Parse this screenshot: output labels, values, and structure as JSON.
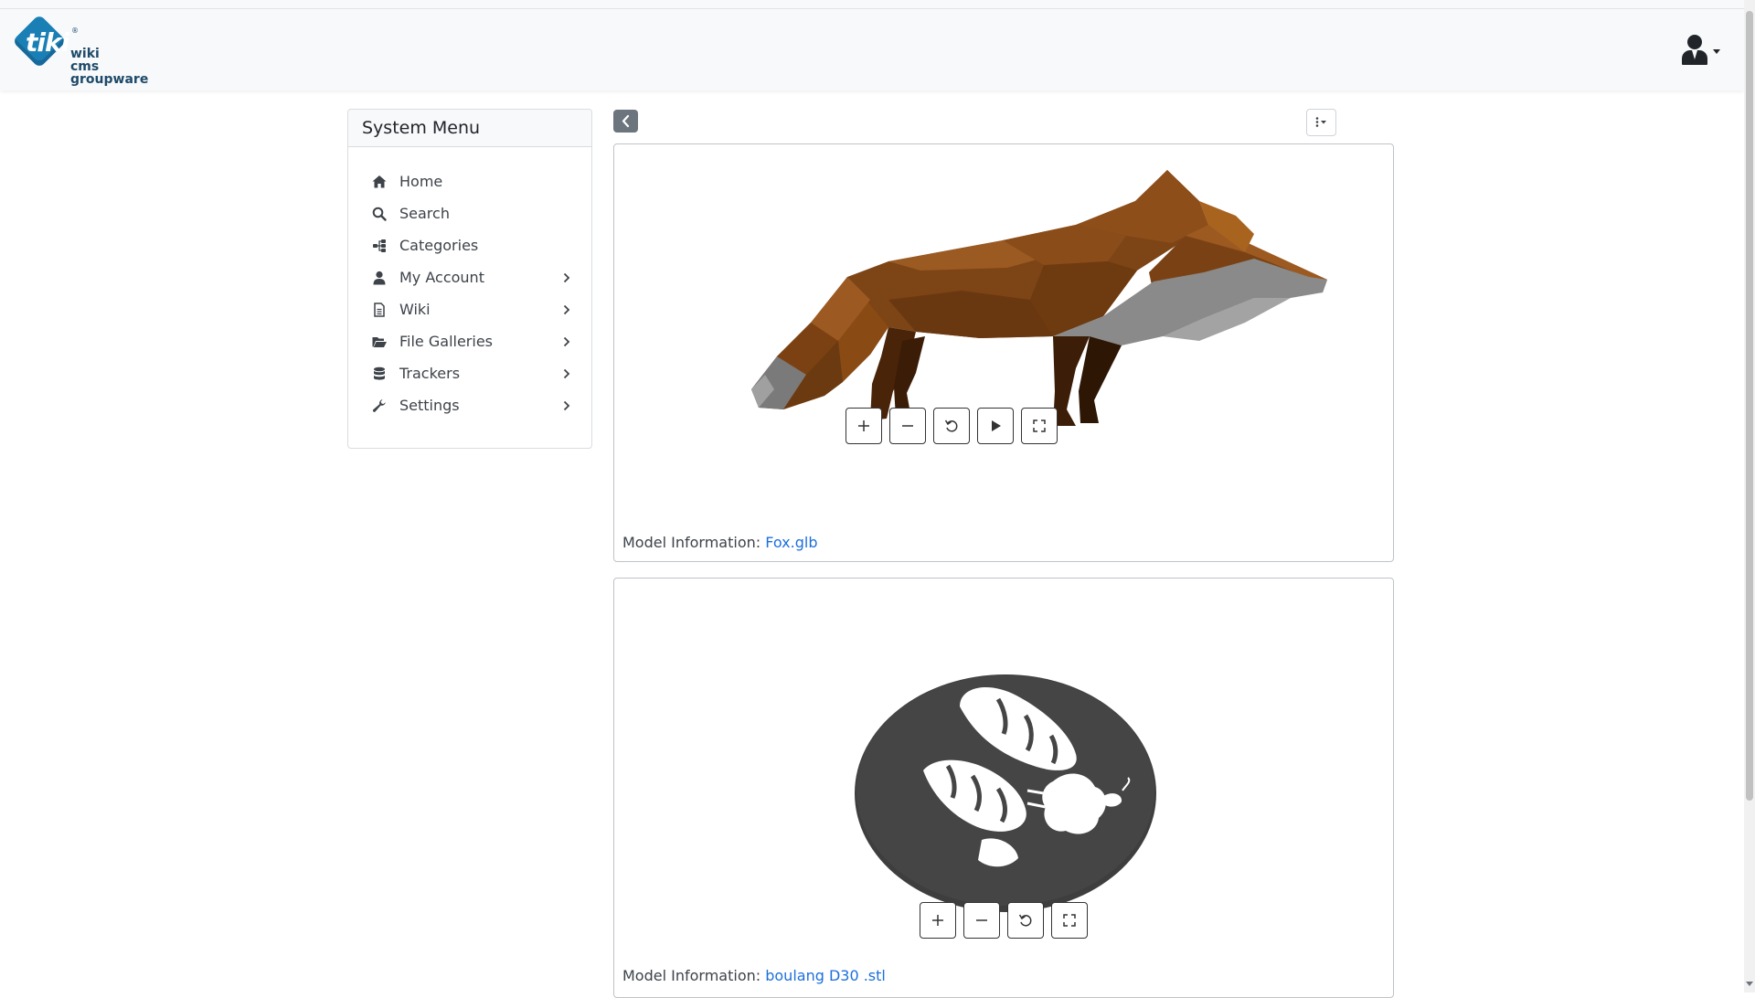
{
  "header": {
    "logo_main": "tiki",
    "logo_reg": "®",
    "logo_lines": [
      "wiki",
      "cms",
      "groupware"
    ],
    "user_menu_icon": "user-tie-icon"
  },
  "system_menu": {
    "title": "System Menu",
    "items": [
      {
        "label": "Home",
        "icon": "home-icon",
        "has_submenu": false
      },
      {
        "label": "Search",
        "icon": "search-icon",
        "has_submenu": false
      },
      {
        "label": "Categories",
        "icon": "sitemap-icon",
        "has_submenu": false
      },
      {
        "label": "My Account",
        "icon": "user-icon",
        "has_submenu": true
      },
      {
        "label": "Wiki",
        "icon": "file-text-icon",
        "has_submenu": true
      },
      {
        "label": "File Galleries",
        "icon": "folder-open-icon",
        "has_submenu": true
      },
      {
        "label": "Trackers",
        "icon": "database-icon",
        "has_submenu": true
      },
      {
        "label": "Settings",
        "icon": "wrench-icon",
        "has_submenu": true
      }
    ]
  },
  "toolbar": {
    "collapse_icon": "chevron-left-icon",
    "options_icon": "ellipsis-vertical-caret-icon"
  },
  "viewers": [
    {
      "model": "fox",
      "info_label": "Model Information:",
      "file_name": "Fox.glb",
      "controls": [
        "zoom-in",
        "zoom-out",
        "reset",
        "play",
        "fullscreen"
      ]
    },
    {
      "model": "stencil",
      "info_label": "Model Information:",
      "file_name": "boulang D30 .stl",
      "controls": [
        "zoom-in",
        "zoom-out",
        "reset",
        "fullscreen"
      ]
    }
  ],
  "colors": {
    "link": "#1d6fdc",
    "header_bg": "#f8f9fa",
    "fox_body": "#8a4a14",
    "fox_belly": "#8f8f8f",
    "stencil_disc": "#3e3e3e"
  }
}
